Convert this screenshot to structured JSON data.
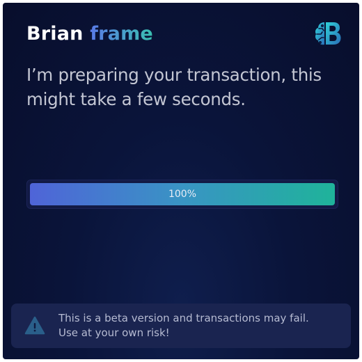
{
  "brand": {
    "first": "Brian",
    "second": "frame",
    "logo_icon": "brain-b-logo-icon"
  },
  "status_message": "I’m preparing your transaction, this might take a few seconds.",
  "progress": {
    "value_percent": 100,
    "label": "100%"
  },
  "alert": {
    "icon": "warning-triangle-icon",
    "text": "This is a beta version and transactions may fail.\nUse at your own risk!"
  },
  "colors": {
    "background": "#0a143a",
    "brand_gradient_start": "#5a7ae8",
    "brand_gradient_end": "#3ac0b0",
    "progress_start": "#4f64d8",
    "progress_end": "#1fb39a",
    "alert_background": "#1a2450"
  }
}
